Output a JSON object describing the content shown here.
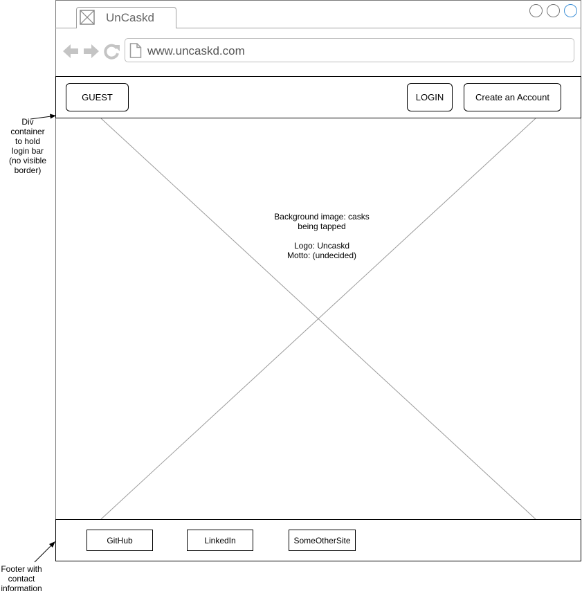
{
  "browser": {
    "tab_title": "UnCaskd",
    "url": "www.uncaskd.com",
    "icons": {
      "tab": "image-placeholder-icon",
      "back": "back-arrow-icon",
      "forward": "forward-arrow-icon",
      "reload": "reload-icon",
      "page": "page-icon"
    },
    "accent": "#3d8fd6"
  },
  "login_bar": {
    "guest_label": "GUEST",
    "login_label": "LOGIN",
    "create_account_label": "Create an Account"
  },
  "hero": {
    "lines": [
      "Background image: casks",
      "being tapped",
      "",
      "Logo: Uncaskd",
      "Motto: (undecided)"
    ]
  },
  "footer": {
    "links": [
      "GitHub",
      "LinkedIn",
      "SomeOtherSite"
    ]
  },
  "annotations": {
    "login_bar_note": [
      "Div",
      "container",
      "to hold",
      "login bar",
      "(no visible",
      "border)"
    ],
    "footer_note": [
      "Footer with",
      "contact",
      "information"
    ]
  }
}
